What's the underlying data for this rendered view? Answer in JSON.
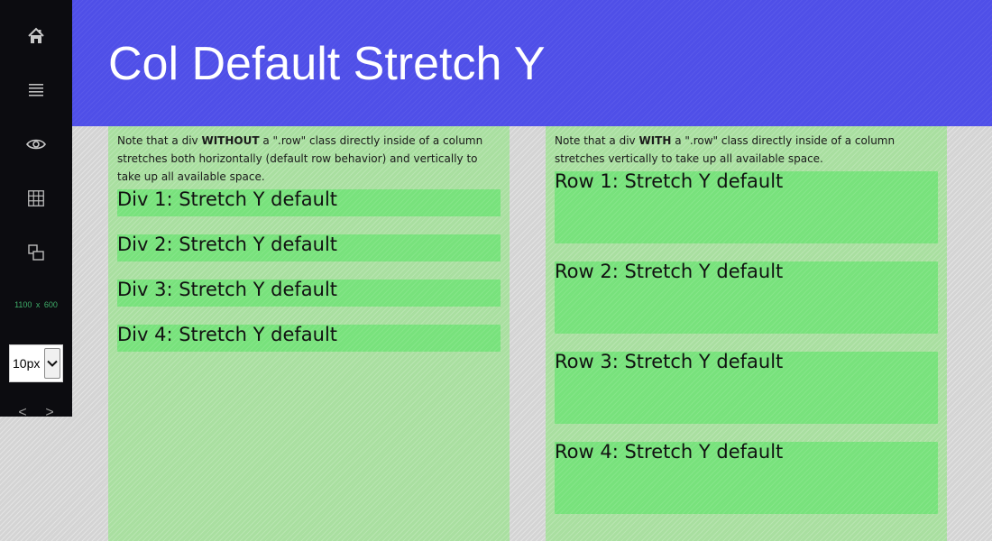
{
  "sidebar": {
    "nav": [
      {
        "icon": "home-icon"
      },
      {
        "icon": "menu-icon"
      },
      {
        "icon": "eye-icon"
      },
      {
        "icon": "grid-icon"
      },
      {
        "icon": "layers-icon"
      }
    ],
    "size_readout": "1100 x 600",
    "unit_select": {
      "value": "10px",
      "options": [
        "10px"
      ]
    },
    "pager": {
      "prev_label": "<",
      "next_label": ">"
    }
  },
  "header": {
    "title": "Col Default Stretch Y"
  },
  "left_column": {
    "note": {
      "before": "Note that a div ",
      "emphasis": "WITHOUT",
      "after": " a \".row\" class directly inside of a column stretches both horizontally (default row behavior) and vertically to take up all available space."
    },
    "items": [
      "Div 1: Stretch Y default",
      "Div 2: Stretch Y default",
      "Div 3: Stretch Y default",
      "Div 4: Stretch Y default"
    ]
  },
  "right_column": {
    "note": {
      "before": "Note that a div ",
      "emphasis": "WITH",
      "after": " a \".row\" class directly inside of a column stretches vertically to take up all available space."
    },
    "items": [
      "Row 1: Stretch Y default",
      "Row 2: Stretch Y default",
      "Row 3: Stretch Y default",
      "Row 4: Stretch Y default"
    ]
  },
  "colors": {
    "header_bg": "#4f4fe8",
    "sidebar_bg": "#0c0c10",
    "column_bg": "#a9dfa0",
    "box_bg": "#78e27c",
    "readout_text": "#3fae6a"
  }
}
